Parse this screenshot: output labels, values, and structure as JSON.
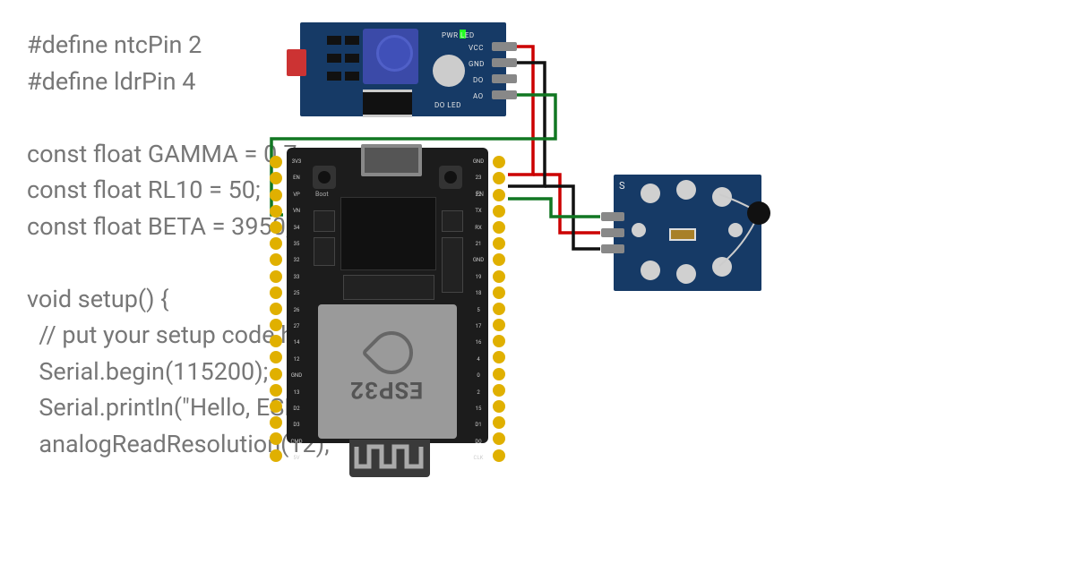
{
  "code": {
    "line1": "#define ntcPin 2",
    "line2": "#define ldrPin 4",
    "blank1": "",
    "line3": "const float GAMMA = 0.7;",
    "line4": "const float RL10 = 50;",
    "line5": "const float BETA = 3950;",
    "blank2": "",
    "line6": "void setup() {",
    "line7": "  // put your setup code here, to run once:",
    "line8": "  Serial.begin(115200);",
    "line9": "  Serial.println(\"Hello, ESP32!\");",
    "line10": "  analogReadResolution(12);"
  },
  "ldr_module": {
    "pwr_led": "PWR\nLED",
    "do_led": "DO\nLED",
    "vcc": "VCC",
    "gnd": "GND",
    "do": "DO",
    "ao": "AO"
  },
  "ntc_module": {
    "s": "S",
    "plus": "+",
    "minus": "−"
  },
  "esp32": {
    "btn_boot": "Boot",
    "btn_en": "EN",
    "shield_text": "ESP32",
    "left_pins": [
      "3V3",
      "EN",
      "VP",
      "VN",
      "34",
      "35",
      "32",
      "33",
      "25",
      "26",
      "27",
      "14",
      "12",
      "GND",
      "13",
      "D2",
      "D3",
      "CMD",
      "5V"
    ],
    "right_pins": [
      "GND",
      "23",
      "22",
      "TX",
      "RX",
      "21",
      "GND",
      "19",
      "18",
      "5",
      "17",
      "16",
      "4",
      "0",
      "2",
      "15",
      "D1",
      "D0",
      "CLK"
    ]
  },
  "wires": {
    "colors": {
      "vcc": "#cc0000",
      "gnd": "#111111",
      "ntc_sig": "#117722",
      "ldr_sig": "#117722"
    }
  }
}
